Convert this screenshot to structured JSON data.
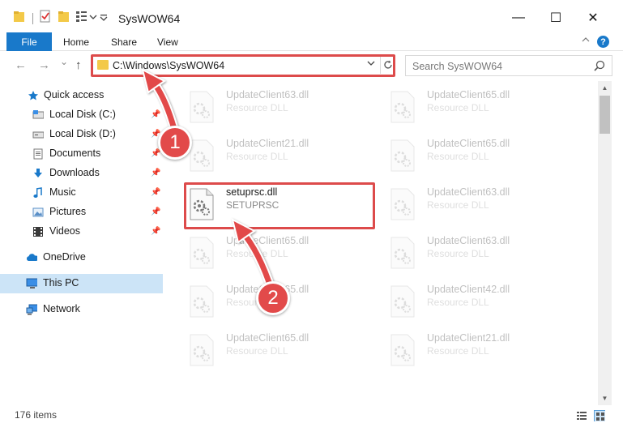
{
  "window": {
    "title": "SysWOW64",
    "minimize_glyph": "—",
    "maximize_glyph": "☐",
    "close_glyph": "✕"
  },
  "ribbon": {
    "tabs": [
      "File",
      "Home",
      "Share",
      "View"
    ],
    "help_label": "?"
  },
  "navbar": {
    "back_glyph": "←",
    "forward_glyph": "→",
    "recent_glyph": "⌄",
    "up_glyph": "↑",
    "address": "C:\\Windows\\SysWOW64",
    "search_placeholder": "Search SysWOW64"
  },
  "sidebar": {
    "items": [
      {
        "label": "Quick access",
        "icon": "star-icon",
        "pinned": false
      },
      {
        "label": "Local Disk (C:)",
        "icon": "drive-icon",
        "pinned": true
      },
      {
        "label": "Local Disk (D:)",
        "icon": "drive-icon",
        "pinned": true
      },
      {
        "label": "Documents",
        "icon": "document-icon",
        "pinned": true
      },
      {
        "label": "Downloads",
        "icon": "download-icon",
        "pinned": true
      },
      {
        "label": "Music",
        "icon": "music-icon",
        "pinned": true
      },
      {
        "label": "Pictures",
        "icon": "pictures-icon",
        "pinned": true
      },
      {
        "label": "Videos",
        "icon": "video-icon",
        "pinned": true
      },
      {
        "label": "OneDrive",
        "icon": "cloud-icon",
        "pinned": false
      },
      {
        "label": "This PC",
        "icon": "computer-icon",
        "pinned": false,
        "selected": true
      },
      {
        "label": "Network",
        "icon": "network-icon",
        "pinned": false
      }
    ]
  },
  "files": {
    "left_column": [
      {
        "name": "UpdateClient63.dll",
        "type": "Resource DLL"
      },
      {
        "name": "UpdateClient21.dll",
        "type": "Resource DLL"
      },
      {
        "name": "setuprsc.dll",
        "type": "SETUPRSC"
      },
      {
        "name": "UpdateClient65.dll",
        "type": "Resource DLL"
      },
      {
        "name": "UpdateClient65.dll",
        "type": "Resource DLL"
      },
      {
        "name": "UpdateClient65.dll",
        "type": "Resource DLL"
      }
    ],
    "right_column": [
      {
        "name": "UpdateClient65.dll",
        "type": "Resource DLL"
      },
      {
        "name": "UpdateClient65.dll",
        "type": "Resource DLL"
      },
      {
        "name": "UpdateClient63.dll",
        "type": "Resource DLL"
      },
      {
        "name": "UpdateClient63.dll",
        "type": "Resource DLL"
      },
      {
        "name": "UpdateClient42.dll",
        "type": "Resource DLL"
      },
      {
        "name": "UpdateClient21.dll",
        "type": "Resource DLL"
      }
    ]
  },
  "status": {
    "item_count": "176 items"
  },
  "annotations": {
    "step1": "1",
    "step2": "2"
  },
  "colors": {
    "accent": "#1979ca",
    "highlight": "#dd4b4b",
    "selected": "#cce4f7"
  }
}
